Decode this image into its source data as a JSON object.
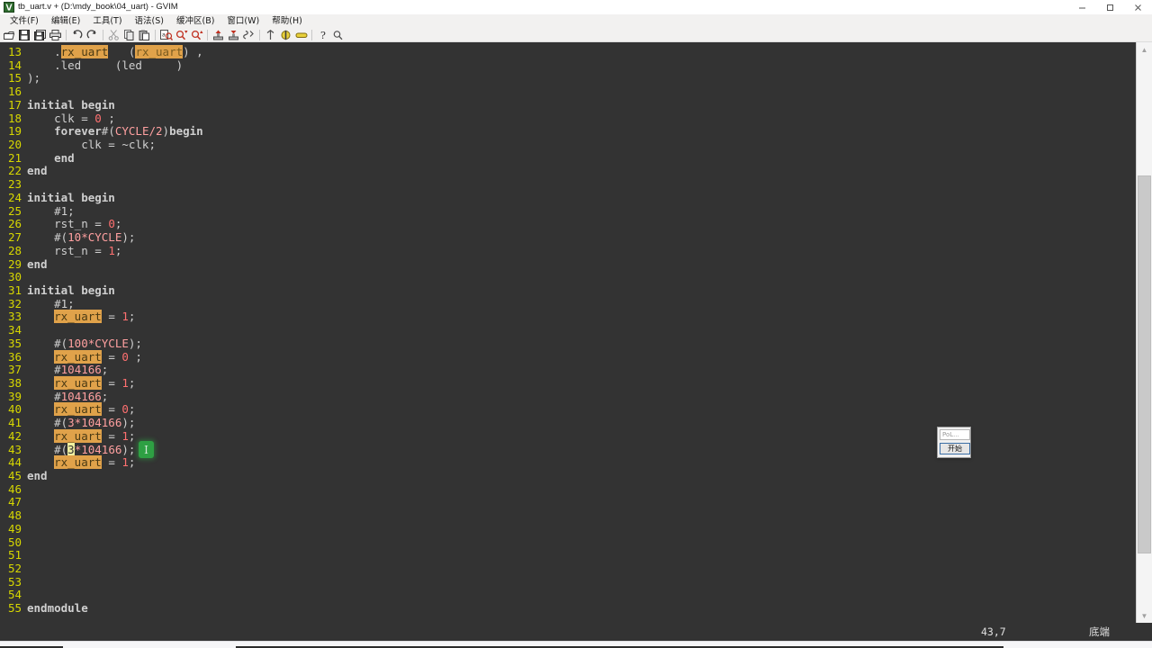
{
  "window": {
    "title": "tb_uart.v + (D:\\mdy_book\\04_uart) - GVIM",
    "icon": "gvim-icon",
    "controls": {
      "minimize": "minimize-icon",
      "maximize": "maximize-icon",
      "close": "close-icon"
    }
  },
  "menubar": {
    "items": [
      {
        "label": "文件(F)",
        "mnemonic": "F"
      },
      {
        "label": "编辑(E)",
        "mnemonic": "E"
      },
      {
        "label": "工具(T)",
        "mnemonic": "T"
      },
      {
        "label": "语法(S)",
        "mnemonic": "S"
      },
      {
        "label": "缓冲区(B)",
        "mnemonic": "B"
      },
      {
        "label": "窗口(W)",
        "mnemonic": "W"
      },
      {
        "label": "帮助(H)",
        "mnemonic": "H"
      }
    ]
  },
  "toolbar": {
    "buttons": [
      "open-file-icon",
      "save-file-icon",
      "save-all-icon",
      "print-icon",
      "undo-icon",
      "redo-icon",
      "cut-icon",
      "copy-icon",
      "paste-icon",
      "find-icon",
      "find-next-icon",
      "find-prev-icon",
      "make-icon",
      "build-icon",
      "shell-icon",
      "tags-icon",
      "tag-jump-icon",
      "bookmark-icon",
      "help-icon",
      "find-help-icon"
    ]
  },
  "editor": {
    "theme": {
      "background": "#333333",
      "line_number_color": "#d7d700",
      "text_color": "#d0d0d0",
      "highlight_background": "#e0a24a",
      "number_color": "#ff7070",
      "preproc_color": "#ffa0a0",
      "cursor_background": "#f0f0a0"
    },
    "first_visible_line": 13,
    "lines": [
      {
        "num": "13",
        "tokens": [
          {
            "t": "    .",
            "c": "plain"
          },
          {
            "t": "rx_uart",
            "c": "hl"
          },
          {
            "t": "   (",
            "c": "plain"
          },
          {
            "t": "rx_uart",
            "c": "hl2"
          },
          {
            "t": ") ,",
            "c": "plain"
          }
        ]
      },
      {
        "num": "14",
        "tokens": [
          {
            "t": "    .led     (led     )",
            "c": "plain"
          }
        ]
      },
      {
        "num": "15",
        "tokens": [
          {
            "t": ");",
            "c": "plain"
          }
        ]
      },
      {
        "num": "16",
        "tokens": [
          {
            "t": "",
            "c": "plain"
          }
        ]
      },
      {
        "num": "17",
        "tokens": [
          {
            "t": "initial begin",
            "c": "kw"
          }
        ]
      },
      {
        "num": "18",
        "tokens": [
          {
            "t": "    clk = ",
            "c": "plain"
          },
          {
            "t": "0",
            "c": "num"
          },
          {
            "t": " ;",
            "c": "plain"
          }
        ]
      },
      {
        "num": "19",
        "tokens": [
          {
            "t": "    forever",
            "c": "kw"
          },
          {
            "t": "#(",
            "c": "plain"
          },
          {
            "t": "CYCLE/2",
            "c": "pre"
          },
          {
            "t": ")",
            "c": "plain"
          },
          {
            "t": "begin",
            "c": "kw"
          }
        ]
      },
      {
        "num": "20",
        "tokens": [
          {
            "t": "        clk = ~clk;",
            "c": "plain"
          }
        ]
      },
      {
        "num": "21",
        "tokens": [
          {
            "t": "    end",
            "c": "kw"
          }
        ]
      },
      {
        "num": "22",
        "tokens": [
          {
            "t": "end",
            "c": "kw"
          }
        ]
      },
      {
        "num": "23",
        "tokens": [
          {
            "t": "",
            "c": "plain"
          }
        ]
      },
      {
        "num": "24",
        "tokens": [
          {
            "t": "initial begin",
            "c": "kw"
          }
        ]
      },
      {
        "num": "25",
        "tokens": [
          {
            "t": "    #1;",
            "c": "plain"
          }
        ]
      },
      {
        "num": "26",
        "tokens": [
          {
            "t": "    rst_n = ",
            "c": "plain"
          },
          {
            "t": "0",
            "c": "num"
          },
          {
            "t": ";",
            "c": "plain"
          }
        ]
      },
      {
        "num": "27",
        "tokens": [
          {
            "t": "    #(",
            "c": "plain"
          },
          {
            "t": "10*CYCLE",
            "c": "pre"
          },
          {
            "t": ");",
            "c": "plain"
          }
        ]
      },
      {
        "num": "28",
        "tokens": [
          {
            "t": "    rst_n = ",
            "c": "plain"
          },
          {
            "t": "1",
            "c": "num"
          },
          {
            "t": ";",
            "c": "plain"
          }
        ]
      },
      {
        "num": "29",
        "tokens": [
          {
            "t": "end",
            "c": "kw"
          }
        ]
      },
      {
        "num": "30",
        "tokens": [
          {
            "t": "",
            "c": "plain"
          }
        ]
      },
      {
        "num": "31",
        "tokens": [
          {
            "t": "initial begin",
            "c": "kw"
          }
        ]
      },
      {
        "num": "32",
        "tokens": [
          {
            "t": "    #1;",
            "c": "plain"
          }
        ]
      },
      {
        "num": "33",
        "tokens": [
          {
            "t": "    ",
            "c": "plain"
          },
          {
            "t": "rx_uart",
            "c": "hl"
          },
          {
            "t": " = ",
            "c": "plain"
          },
          {
            "t": "1",
            "c": "num"
          },
          {
            "t": ";",
            "c": "plain"
          }
        ]
      },
      {
        "num": "34",
        "tokens": [
          {
            "t": "",
            "c": "plain"
          }
        ]
      },
      {
        "num": "35",
        "tokens": [
          {
            "t": "    #(",
            "c": "plain"
          },
          {
            "t": "100*CYCLE",
            "c": "pre"
          },
          {
            "t": ");",
            "c": "plain"
          }
        ]
      },
      {
        "num": "36",
        "tokens": [
          {
            "t": "    ",
            "c": "plain"
          },
          {
            "t": "rx_uart",
            "c": "hl"
          },
          {
            "t": " = ",
            "c": "plain"
          },
          {
            "t": "0",
            "c": "num"
          },
          {
            "t": " ;",
            "c": "plain"
          }
        ]
      },
      {
        "num": "37",
        "tokens": [
          {
            "t": "    #",
            "c": "plain"
          },
          {
            "t": "104166",
            "c": "pre"
          },
          {
            "t": ";",
            "c": "plain"
          }
        ]
      },
      {
        "num": "38",
        "tokens": [
          {
            "t": "    ",
            "c": "plain"
          },
          {
            "t": "rx_uart",
            "c": "hl"
          },
          {
            "t": " = ",
            "c": "plain"
          },
          {
            "t": "1",
            "c": "num"
          },
          {
            "t": ";",
            "c": "plain"
          }
        ]
      },
      {
        "num": "39",
        "tokens": [
          {
            "t": "    #",
            "c": "plain"
          },
          {
            "t": "104166",
            "c": "pre"
          },
          {
            "t": ";",
            "c": "plain"
          }
        ]
      },
      {
        "num": "40",
        "tokens": [
          {
            "t": "    ",
            "c": "plain"
          },
          {
            "t": "rx_uart",
            "c": "hl"
          },
          {
            "t": " = ",
            "c": "plain"
          },
          {
            "t": "0",
            "c": "num"
          },
          {
            "t": ";",
            "c": "plain"
          }
        ]
      },
      {
        "num": "41",
        "tokens": [
          {
            "t": "    #(",
            "c": "plain"
          },
          {
            "t": "3*104166",
            "c": "pre"
          },
          {
            "t": ");",
            "c": "plain"
          }
        ]
      },
      {
        "num": "42",
        "tokens": [
          {
            "t": "    ",
            "c": "plain"
          },
          {
            "t": "rx_uart",
            "c": "hl"
          },
          {
            "t": " = ",
            "c": "plain"
          },
          {
            "t": "1",
            "c": "num"
          },
          {
            "t": ";",
            "c": "plain"
          }
        ]
      },
      {
        "num": "43",
        "tokens": [
          {
            "t": "    #(",
            "c": "plain"
          },
          {
            "t": "3",
            "c": "cursor"
          },
          {
            "t": "*104166",
            "c": "pre"
          },
          {
            "t": ");",
            "c": "plain"
          }
        ]
      },
      {
        "num": "44",
        "tokens": [
          {
            "t": "    ",
            "c": "plain"
          },
          {
            "t": "rx_uart",
            "c": "hl"
          },
          {
            "t": " = ",
            "c": "plain"
          },
          {
            "t": "1",
            "c": "num"
          },
          {
            "t": ";",
            "c": "plain"
          }
        ]
      },
      {
        "num": "45",
        "tokens": [
          {
            "t": "end",
            "c": "kw"
          }
        ]
      },
      {
        "num": "46",
        "tokens": [
          {
            "t": "",
            "c": "plain"
          }
        ]
      },
      {
        "num": "47",
        "tokens": [
          {
            "t": "",
            "c": "plain"
          }
        ]
      },
      {
        "num": "48",
        "tokens": [
          {
            "t": "",
            "c": "plain"
          }
        ]
      },
      {
        "num": "49",
        "tokens": [
          {
            "t": "",
            "c": "plain"
          }
        ]
      },
      {
        "num": "50",
        "tokens": [
          {
            "t": "",
            "c": "plain"
          }
        ]
      },
      {
        "num": "51",
        "tokens": [
          {
            "t": "",
            "c": "plain"
          }
        ]
      },
      {
        "num": "52",
        "tokens": [
          {
            "t": "",
            "c": "plain"
          }
        ]
      },
      {
        "num": "53",
        "tokens": [
          {
            "t": "",
            "c": "plain"
          }
        ]
      },
      {
        "num": "54",
        "tokens": [
          {
            "t": "",
            "c": "plain"
          }
        ]
      },
      {
        "num": "55",
        "tokens": [
          {
            "t": "endmodule",
            "c": "kw"
          }
        ]
      }
    ]
  },
  "mouse": {
    "cursor": "i-beam-caret"
  },
  "scrollbar": {
    "up_arrow": "▲",
    "down_arrow": "▼"
  },
  "statusbar": {
    "left": "",
    "position": "43,7",
    "state": "底端"
  },
  "tool_dialog": {
    "input_value": "PoL...",
    "button_label": "开始"
  }
}
